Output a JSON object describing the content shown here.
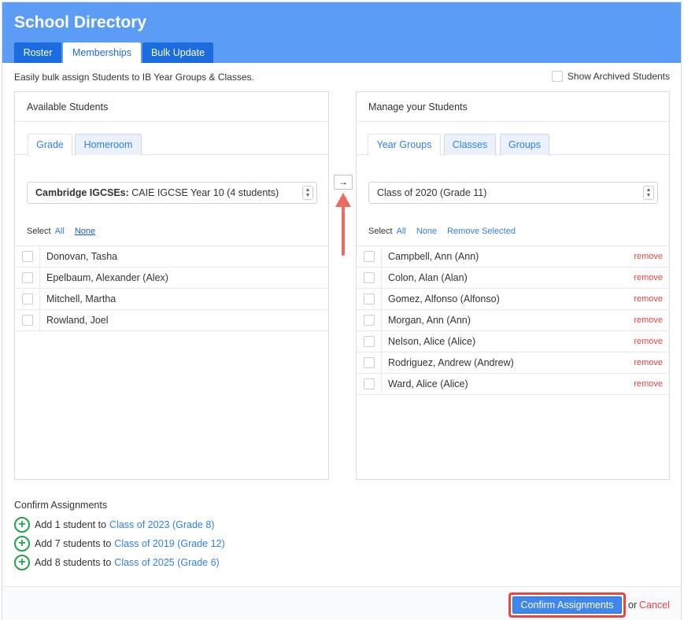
{
  "app": {
    "title": "School Directory"
  },
  "nav_tabs": [
    {
      "label": "Roster",
      "active": false
    },
    {
      "label": "Memberships",
      "active": true
    },
    {
      "label": "Bulk Update",
      "active": false
    }
  ],
  "intro_text": "Easily bulk assign Students to IB Year Groups & Classes.",
  "show_archived_label": "Show Archived Students",
  "left_panel": {
    "title": "Available Students",
    "tabs": [
      {
        "label": "Grade",
        "active": true
      },
      {
        "label": "Homeroom",
        "active": false
      }
    ],
    "select": {
      "bold_prefix": "Cambridge IGCSEs:",
      "value": "CAIE IGCSE Year 10 (4 students)"
    },
    "select_controls": {
      "label": "Select",
      "all": "All",
      "none": "None"
    },
    "students": [
      {
        "name": "Donovan, Tasha"
      },
      {
        "name": "Epelbaum, Alexander (Alex)"
      },
      {
        "name": "Mitchell, Martha"
      },
      {
        "name": "Rowland, Joel"
      }
    ]
  },
  "move_button": {
    "glyph": "→"
  },
  "right_panel": {
    "title": "Manage your Students",
    "tabs": [
      {
        "label": "Year Groups",
        "active": true
      },
      {
        "label": "Classes",
        "active": false
      },
      {
        "label": "Groups",
        "active": false
      }
    ],
    "select": {
      "value": "Class of 2020 (Grade 11)"
    },
    "select_controls": {
      "label": "Select",
      "all": "All",
      "none": "None",
      "remove_selected": "Remove Selected"
    },
    "remove_label": "remove",
    "students": [
      {
        "name": "Campbell, Ann (Ann)"
      },
      {
        "name": "Colon, Alan (Alan)"
      },
      {
        "name": "Gomez, Alfonso (Alfonso)"
      },
      {
        "name": "Morgan, Ann (Ann)"
      },
      {
        "name": "Nelson, Alice (Alice)"
      },
      {
        "name": "Rodriguez, Andrew (Andrew)"
      },
      {
        "name": "Ward, Alice (Alice)"
      }
    ]
  },
  "confirm_section": {
    "title": "Confirm Assignments",
    "assignments": [
      {
        "text": "Add 1 student to",
        "link": "Class of 2023 (Grade 8)"
      },
      {
        "text": "Add 7 students to",
        "link": "Class of 2019 (Grade 12)"
      },
      {
        "text": "Add 8 students to",
        "link": "Class of 2025 (Grade 6)"
      }
    ]
  },
  "footer": {
    "confirm_button": "Confirm Assignments",
    "or_text": "or",
    "cancel": "Cancel"
  },
  "colors": {
    "header": "#5b9cf6",
    "tab_blue": "#1a6ce0",
    "link": "#2f80e8",
    "remove": "#e54242",
    "add_icon": "#22a24a",
    "highlight": "#e8463e"
  }
}
